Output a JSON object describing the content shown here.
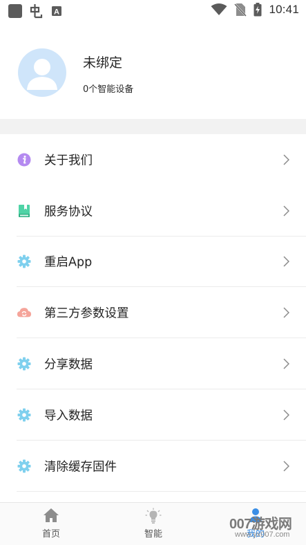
{
  "status_bar": {
    "time": "10:41",
    "icons": [
      "app-square-icon",
      "bug-icon",
      "keyboard-a-icon",
      "wifi-icon",
      "no-sim-icon",
      "battery-charging-icon"
    ],
    "keyboard_letter": "A"
  },
  "profile": {
    "name": "未绑定",
    "devices": "0个智能设备"
  },
  "menu": {
    "items": [
      {
        "label": "关于我们",
        "icon": "info-icon",
        "color": "#b48af0"
      },
      {
        "label": "服务协议",
        "icon": "book-icon",
        "color": "#4fd3a6"
      },
      {
        "label": "重启App",
        "icon": "gear-icon",
        "color": "#7fd0ee"
      },
      {
        "label": "第三方参数设置",
        "icon": "cloud-sync-icon",
        "color": "#f5a49a"
      },
      {
        "label": "分享数据",
        "icon": "gear-icon",
        "color": "#7fd0ee"
      },
      {
        "label": "导入数据",
        "icon": "gear-icon",
        "color": "#7fd0ee"
      },
      {
        "label": "清除缓存固件",
        "icon": "gear-icon",
        "color": "#7fd0ee"
      }
    ]
  },
  "bottom_nav": {
    "items": [
      {
        "label": "首页",
        "icon": "home-icon"
      },
      {
        "label": "智能",
        "icon": "bulb-icon"
      },
      {
        "label": "我的",
        "icon": "person-icon",
        "active": true
      }
    ],
    "active_color": "#3a8ee6"
  },
  "watermark": {
    "text": "007游戏网",
    "url": "www.yx007.com"
  },
  "colors": {
    "avatar_bg": "#cfe5fa",
    "separator": "#f2f2f2",
    "chevron": "#8a8a8a"
  }
}
